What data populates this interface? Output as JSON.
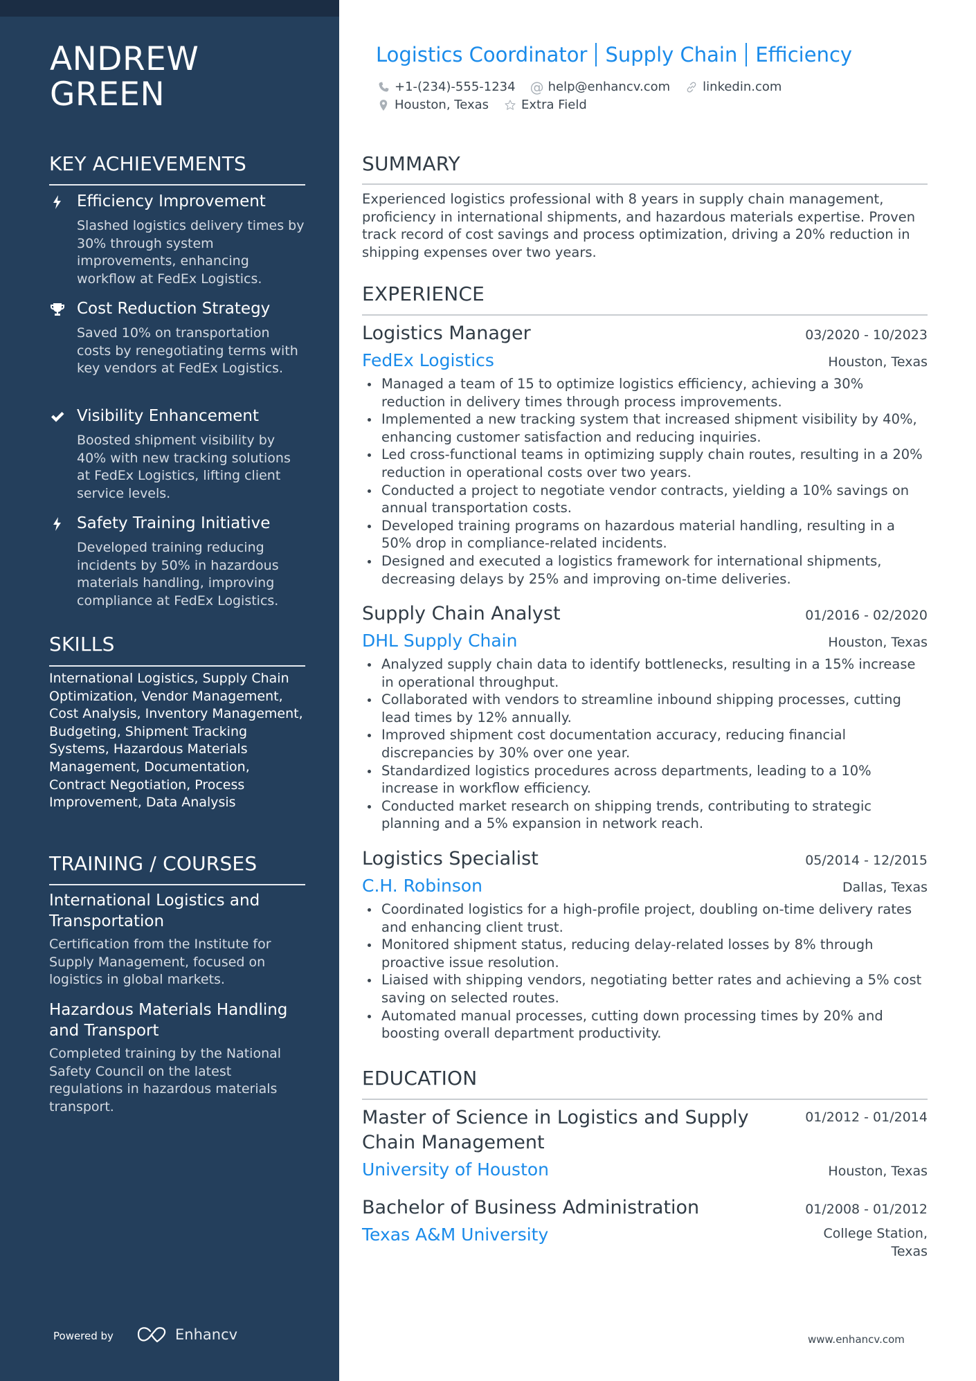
{
  "header": {
    "name_line1": "ANDREW",
    "name_line2": "GREEN",
    "title_parts": [
      "Logistics Coordinator",
      "Supply Chain",
      "Efficiency"
    ],
    "contact": {
      "phone": "+1-(234)-555-1234",
      "email": "help@enhancv.com",
      "link": "linkedin.com",
      "location": "Houston, Texas",
      "extra": "Extra Field"
    }
  },
  "sidebar": {
    "achievements_heading": "KEY ACHIEVEMENTS",
    "achievements": [
      {
        "icon": "bolt-icon",
        "title": "Efficiency Improvement",
        "description": "Slashed logistics delivery times by 30% through system improvements, enhancing workflow at FedEx Logistics."
      },
      {
        "icon": "trophy-icon",
        "title": "Cost Reduction Strategy",
        "description": "Saved 10% on transportation costs by renegotiating terms with key vendors at FedEx Logistics."
      },
      {
        "icon": "check-icon",
        "title": "Visibility Enhancement",
        "description": "Boosted shipment visibility by 40% with new tracking solutions at FedEx Logistics, lifting client service levels."
      },
      {
        "icon": "bolt-icon",
        "title": "Safety Training Initiative",
        "description": "Developed training reducing incidents by 50% in hazardous materials handling, improving compliance at FedEx Logistics."
      }
    ],
    "skills_heading": "SKILLS",
    "skills_text": "International Logistics, Supply Chain Optimization, Vendor Management, Cost Analysis, Inventory Management, Budgeting, Shipment Tracking Systems, Hazardous Materials Management, Documentation, Contract Negotiation, Process Improvement, Data Analysis",
    "training_heading": "TRAINING / COURSES",
    "courses": [
      {
        "title": "International Logistics and Transportation",
        "description": "Certification from the Institute for Supply Management, focused on logistics in global markets."
      },
      {
        "title": "Hazardous Materials Handling and Transport",
        "description": "Completed training by the National Safety Council on the latest regulations in hazardous materials transport."
      }
    ],
    "powered_by": "Powered by",
    "brand": "Enhancv"
  },
  "main": {
    "summary_heading": "SUMMARY",
    "summary": "Experienced logistics professional with 8 years in supply chain management, proficiency in international shipments, and hazardous materials expertise. Proven track record of cost savings and process optimization, driving a 20% reduction in shipping expenses over two years.",
    "experience_heading": "EXPERIENCE",
    "jobs": [
      {
        "role": "Logistics Manager",
        "dates": "03/2020 - 10/2023",
        "company": "FedEx Logistics",
        "location": "Houston, Texas",
        "bullets": [
          "Managed a team of 15 to optimize logistics efficiency, achieving a 30% reduction in delivery times through process improvements.",
          "Implemented a new tracking system that increased shipment visibility by 40%, enhancing customer satisfaction and reducing inquiries.",
          "Led cross-functional teams in optimizing supply chain routes, resulting in a 20% reduction in operational costs over two years.",
          "Conducted a project to negotiate vendor contracts, yielding a 10% savings on annual transportation costs.",
          "Developed training programs on hazardous material handling, resulting in a 50% drop in compliance-related incidents.",
          "Designed and executed a logistics framework for international shipments, decreasing delays by 25% and improving on-time deliveries."
        ]
      },
      {
        "role": "Supply Chain Analyst",
        "dates": "01/2016 - 02/2020",
        "company": "DHL Supply Chain",
        "location": "Houston, Texas",
        "bullets": [
          "Analyzed supply chain data to identify bottlenecks, resulting in a 15% increase in operational throughput.",
          "Collaborated with vendors to streamline inbound shipping processes, cutting lead times by 12% annually.",
          "Improved shipment cost documentation accuracy, reducing financial discrepancies by 30% over one year.",
          "Standardized logistics procedures across departments, leading to a 10% increase in workflow efficiency.",
          "Conducted market research on shipping trends, contributing to strategic planning and a 5% expansion in network reach."
        ]
      },
      {
        "role": "Logistics Specialist",
        "dates": "05/2014 - 12/2015",
        "company": "C.H. Robinson",
        "location": "Dallas, Texas",
        "bullets": [
          "Coordinated logistics for a high-profile project, doubling on-time delivery rates and enhancing client trust.",
          "Monitored shipment status, reducing delay-related losses by 8% through proactive issue resolution.",
          "Liaised with shipping vendors, negotiating better rates and achieving a 5% cost saving on selected routes.",
          "Automated manual processes, cutting down processing times by 20% and boosting overall department productivity."
        ]
      }
    ],
    "education_heading": "EDUCATION",
    "education": [
      {
        "degree": "Master of Science in Logistics and Supply Chain Management",
        "dates": "01/2012 - 01/2014",
        "school": "University of Houston",
        "location": "Houston, Texas"
      },
      {
        "degree": "Bachelor of Business Administration",
        "dates": "01/2008 - 01/2012",
        "school": "Texas A&M University",
        "location": "College Station, Texas"
      }
    ]
  },
  "footer": {
    "url": "www.enhancv.com"
  },
  "colors": {
    "sidebar": "#243f5c",
    "accent": "#1a8bea",
    "text": "#3b4650"
  }
}
